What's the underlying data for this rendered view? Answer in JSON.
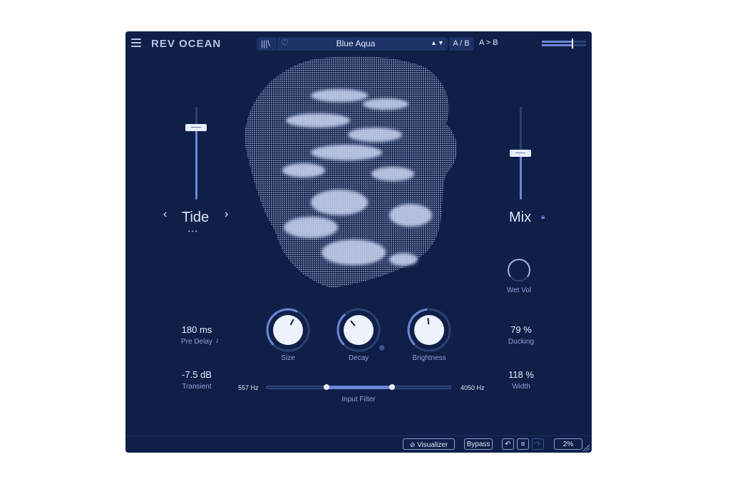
{
  "header": {
    "app_title": "REV OCEAN",
    "preset_name": "Blue Aqua",
    "preset_arrows": "▲▼",
    "ab_label": "A / B",
    "ab_copy_label": "A > B",
    "menu_icon": "hamburger-icon",
    "library_icon": "library-icon",
    "favorite_icon": "heart-icon"
  },
  "left": {
    "mode_label": "Tide",
    "prev_arrow": "‹",
    "next_arrow": "›",
    "dots": "•••",
    "tide_slider_level": 0.78
  },
  "right": {
    "mix_label": "Mix",
    "mix_slider_level": 0.5,
    "lock_icon": "lock-icon",
    "wet_vol_label": "Wet Vol"
  },
  "params": {
    "pre_delay_value": "180 ms",
    "pre_delay_label": "Pre Delay",
    "transient_value": "-7.5 dB",
    "transient_label": "Transient",
    "ducking_value": "79 %",
    "ducking_label": "Ducking",
    "width_value": "118 %",
    "width_label": "Width"
  },
  "knobs": {
    "size_label": "Size",
    "decay_label": "Decay",
    "brightness_label": "Brightness",
    "size_level": 0.6,
    "decay_level": 0.35,
    "brightness_level": 0.48
  },
  "filter": {
    "low_label": "557 Hz",
    "high_label": "4050 Hz",
    "title": "Input Filter"
  },
  "footer": {
    "visualizer_label": "Visualizer",
    "bypass_label": "Bypass",
    "cpu_label": "2%"
  },
  "colors": {
    "background": "#0f1f48",
    "accent": "#6b87d8",
    "text": "#dfe6f7"
  }
}
